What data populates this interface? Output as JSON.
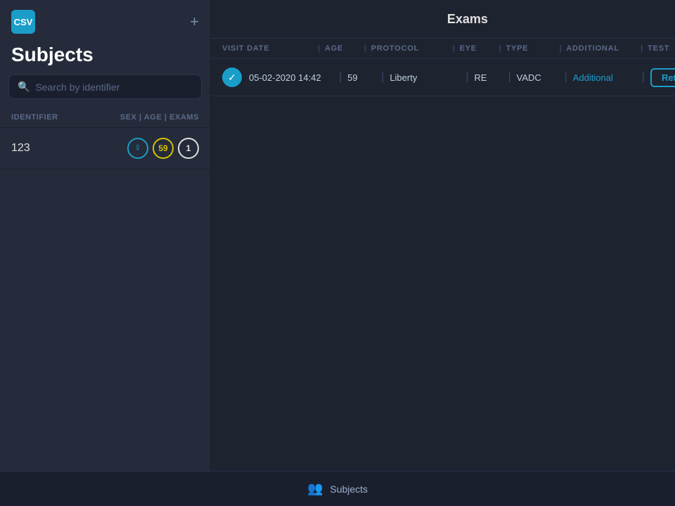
{
  "app": {
    "logo_text": "CSV",
    "bottom_nav_label": "Subjects"
  },
  "sidebar": {
    "title": "Subjects",
    "add_button_label": "+",
    "search_placeholder": "Search by identifier",
    "list_header": {
      "identifier": "IDENTIFIER",
      "sex_age_exams": "SEX | AGE | EXAMS"
    },
    "subjects": [
      {
        "id": "123",
        "sex_icon": "♀",
        "age": "59",
        "exams": "1"
      }
    ]
  },
  "exams": {
    "title": "Exams",
    "add_button_label": "+",
    "columns": {
      "visit_date": "VISIT DATE",
      "age": "AGE",
      "protocol": "PROTOCOL",
      "eye": "EYE",
      "type": "TYPE",
      "additional": "ADDITIONAL",
      "test": "TEST"
    },
    "rows": [
      {
        "date": "05-02-2020 14:42",
        "age": "59",
        "protocol": "Liberty",
        "eye": "RE",
        "type": "VADC",
        "additional": "Additional",
        "retest_label": "Retest"
      }
    ]
  }
}
